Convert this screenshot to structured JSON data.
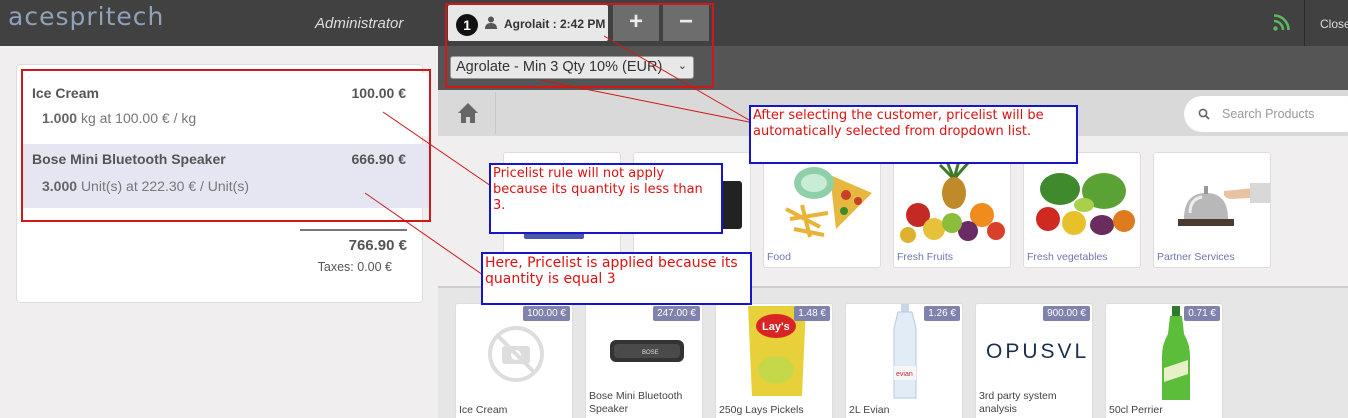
{
  "topbar": {
    "logo": "acespritech",
    "user": "Administrator",
    "order_number": "1",
    "order_label": "Agrolait : 2:42 PM",
    "add_label": "+",
    "remove_label": "−",
    "close_label": "Close"
  },
  "pricelist": {
    "selected": "Agrolate - Min 3 Qty 10% (EUR)"
  },
  "search": {
    "placeholder": "Search Products"
  },
  "order": {
    "lines": [
      {
        "name": "Ice Cream",
        "price": "100.00 €",
        "qty": "1.000",
        "detail": "kg at 100.00 € / kg"
      },
      {
        "name": "Bose Mini Bluetooth Speaker",
        "price": "666.90 €",
        "qty": "3.000",
        "detail": "Unit(s) at 222.30 € / Unit(s)"
      }
    ],
    "total": "766.90 €",
    "taxes": "Taxes: 0.00 €"
  },
  "categories": [
    {
      "label": "Food",
      "icon": "food-image"
    },
    {
      "label": "Fresh Fruits",
      "icon": "fruits-image"
    },
    {
      "label": "Fresh vegetables",
      "icon": "vegetables-image"
    },
    {
      "label": "Partner Services",
      "icon": "bell-image"
    }
  ],
  "products": [
    {
      "name": "Ice Cream",
      "price": "100.00 €",
      "icon": "no-image-camera"
    },
    {
      "name": "Bose Mini Bluetooth Speaker",
      "price": "247.00 €",
      "icon": "speaker-image"
    },
    {
      "name": "250g Lays Pickels",
      "price": "1.48 €",
      "icon": "chips-bag-image"
    },
    {
      "name": "2L Evian",
      "price": "1.26 €",
      "icon": "water-bottle-image"
    },
    {
      "name": "3rd party system analysis",
      "price": "900.00 €",
      "icon": "opusvl-logo",
      "logo_text": "OPUSVL"
    },
    {
      "name": "50cl Perrier",
      "price": "0.71 €",
      "icon": "green-bottle-image"
    }
  ],
  "annotations": {
    "note_pricelist": "After selecting the customer, pricelist will be automatically selected from dropdown list.",
    "note_not_apply": "Pricelist rule will not apply because its quantity is less than 3.",
    "note_applied": "Here, Pricelist is applied because its quantity is equal 3"
  },
  "colors": {
    "annotation_red": "#d01818",
    "annotation_blue": "#1616c8",
    "price_tag": "#7f82ac",
    "category_label": "#6e76b0"
  }
}
